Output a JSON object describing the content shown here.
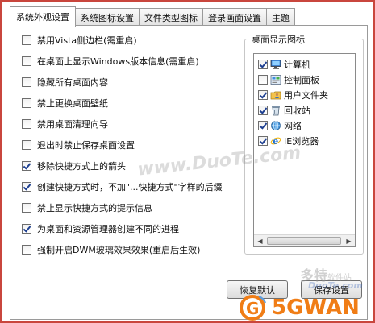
{
  "tabs": [
    {
      "label": "系统外观设置",
      "active": true
    },
    {
      "label": "系统图标设置",
      "active": false
    },
    {
      "label": "文件类型图标",
      "active": false
    },
    {
      "label": "登录画面设置",
      "active": false
    },
    {
      "label": "主题",
      "active": false
    }
  ],
  "options": [
    {
      "label": "禁用Vista侧边栏(需重启)",
      "checked": false
    },
    {
      "label": "在桌面上显示Windows版本信息(需重启)",
      "checked": false
    },
    {
      "label": "隐藏所有桌面内容",
      "checked": false
    },
    {
      "label": "禁止更换桌面壁纸",
      "checked": false
    },
    {
      "label": "禁用桌面清理向导",
      "checked": false
    },
    {
      "label": "退出时禁止保存桌面设置",
      "checked": false
    },
    {
      "label": "移除快捷方式上的箭头",
      "checked": true
    },
    {
      "label": "创建快捷方式时，不加\"...快捷方式\"字样的后缀",
      "checked": true
    },
    {
      "label": "禁止显示快捷方式的提示信息",
      "checked": false
    },
    {
      "label": "为桌面和资源管理器创建不同的进程",
      "checked": true
    },
    {
      "label": "强制开启DWM玻璃效果效果(重启后生效)",
      "checked": false
    }
  ],
  "desktop_icons": {
    "title": "桌面显示图标",
    "items": [
      {
        "label": "计算机",
        "checked": true,
        "icon": "computer-icon"
      },
      {
        "label": "控制面板",
        "checked": false,
        "icon": "control-panel-icon"
      },
      {
        "label": "用户文件夹",
        "checked": true,
        "icon": "user-folder-icon"
      },
      {
        "label": "回收站",
        "checked": true,
        "icon": "recycle-bin-icon"
      },
      {
        "label": "网络",
        "checked": true,
        "icon": "network-icon"
      },
      {
        "label": "IE浏览器",
        "checked": true,
        "icon": "ie-icon"
      }
    ]
  },
  "buttons": {
    "restore": "恢复默认",
    "save": "保存设置"
  },
  "watermarks": {
    "site": "www.DuoTe.com",
    "brand_cn": "多特",
    "brand_sub": "软件站",
    "brand_en": "DuoTe.com",
    "logo_text": "5GWAN"
  },
  "colors": {
    "frame_border": "#c9463d",
    "check_mark": "#1d3f91",
    "logo_orange": "#f07d16"
  }
}
